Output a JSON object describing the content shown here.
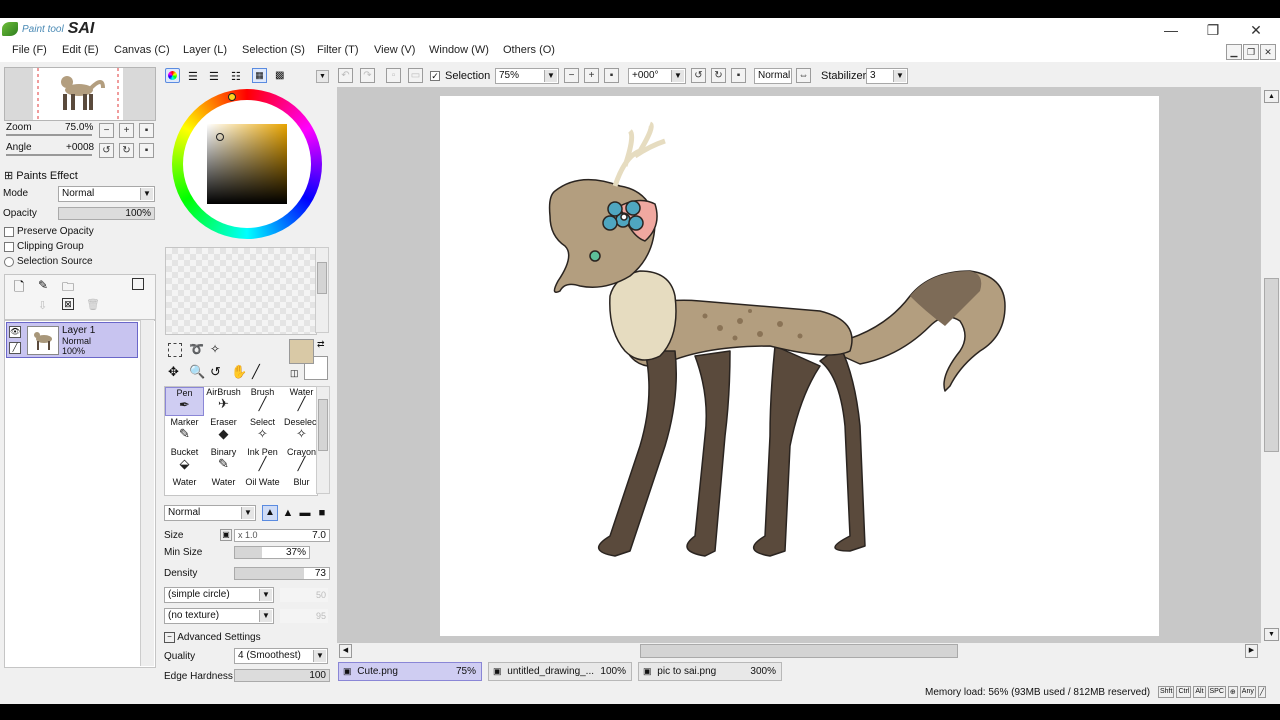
{
  "app": {
    "logo_small": "Paint tool",
    "logo_big": "SAI"
  },
  "window_controls": {
    "minimize": "—",
    "restore": "❐",
    "close": "✕"
  },
  "menu": [
    "File (F)",
    "Edit (E)",
    "Canvas (C)",
    "Layer (L)",
    "Selection (S)",
    "Filter (T)",
    "View (V)",
    "Window (W)",
    "Others (O)"
  ],
  "navigator": {
    "zoom_label": "Zoom",
    "zoom_value": "75.0%",
    "angle_label": "Angle",
    "angle_value": "+0008"
  },
  "layer_panel": {
    "paints_effect": "Paints Effect",
    "mode_label": "Mode",
    "mode_value": "Normal",
    "opacity_label": "Opacity",
    "opacity_value": "100%",
    "preserve_opacity": "Preserve Opacity",
    "clipping_group": "Clipping Group",
    "selection_source": "Selection Source",
    "layers": [
      {
        "name": "Layer 1",
        "mode": "Normal",
        "opacity": "100%"
      }
    ]
  },
  "colors": {
    "current": "#d9c9a6",
    "accent": "#c8c4f0"
  },
  "tools": [
    {
      "label": "Pen",
      "icon": "pen-icon",
      "glyph": "✒"
    },
    {
      "label": "AirBrush",
      "icon": "airbrush-icon",
      "glyph": "✈"
    },
    {
      "label": "Brush",
      "icon": "brush-icon",
      "glyph": "╱"
    },
    {
      "label": "Water",
      "icon": "water-brush-icon",
      "glyph": "╱"
    },
    {
      "label": "Marker",
      "icon": "marker-icon",
      "glyph": "✎"
    },
    {
      "label": "Eraser",
      "icon": "eraser-icon",
      "glyph": "◆"
    },
    {
      "label": "Select",
      "icon": "select-icon",
      "glyph": "✧"
    },
    {
      "label": "Deselect",
      "icon": "deselect-icon",
      "glyph": "✧"
    },
    {
      "label": "Bucket",
      "icon": "bucket-icon",
      "glyph": "⬙"
    },
    {
      "label": "Binary",
      "icon": "binary-pen-icon",
      "glyph": "✎"
    },
    {
      "label": "Ink Pen",
      "icon": "ink-pen-icon",
      "glyph": "╱"
    },
    {
      "label": "Crayon",
      "icon": "crayon-icon",
      "glyph": "╱"
    },
    {
      "label": "Water",
      "icon": "water-icon",
      "glyph": ""
    },
    {
      "label": "Water",
      "icon": "water-icon",
      "glyph": ""
    },
    {
      "label": "Oil Wate",
      "icon": "oil-water-icon",
      "glyph": ""
    },
    {
      "label": "Blur",
      "icon": "blur-icon",
      "glyph": ""
    }
  ],
  "brush": {
    "blend_mode": "Normal",
    "size_label": "Size",
    "size_mult": "x 1.0",
    "size_value": "7.0",
    "minsize_label": "Min Size",
    "minsize_value": "37%",
    "minsize_fraction": 0.37,
    "density_label": "Density",
    "density_value": "73",
    "density_fraction": 0.73,
    "shape": "(simple circle)",
    "shape_val": "50",
    "texture": "(no texture)",
    "texture_val": "95",
    "advanced": "Advanced Settings",
    "quality_label": "Quality",
    "quality_value": "4 (Smoothest)",
    "edge_label": "Edge Hardness",
    "edge_value": "100"
  },
  "toolbar": {
    "selection_label": "Selection",
    "zoom": "75%",
    "angle": "+000°",
    "blend": "Normal",
    "stabilizer_label": "Stabilizer",
    "stabilizer_value": "3"
  },
  "tabs": [
    {
      "name": "Cute.png",
      "zoom": "75%"
    },
    {
      "name": "untitled_drawing_...",
      "zoom": "100%"
    },
    {
      "name": "pic to sai.png",
      "zoom": "300%"
    }
  ],
  "status": {
    "memory": "Memory load: 56% (93MB used / 812MB reserved)",
    "keys": [
      "Shft",
      "Ctrl",
      "Alt",
      "SPC",
      "⊕",
      "Any",
      "╱"
    ]
  }
}
